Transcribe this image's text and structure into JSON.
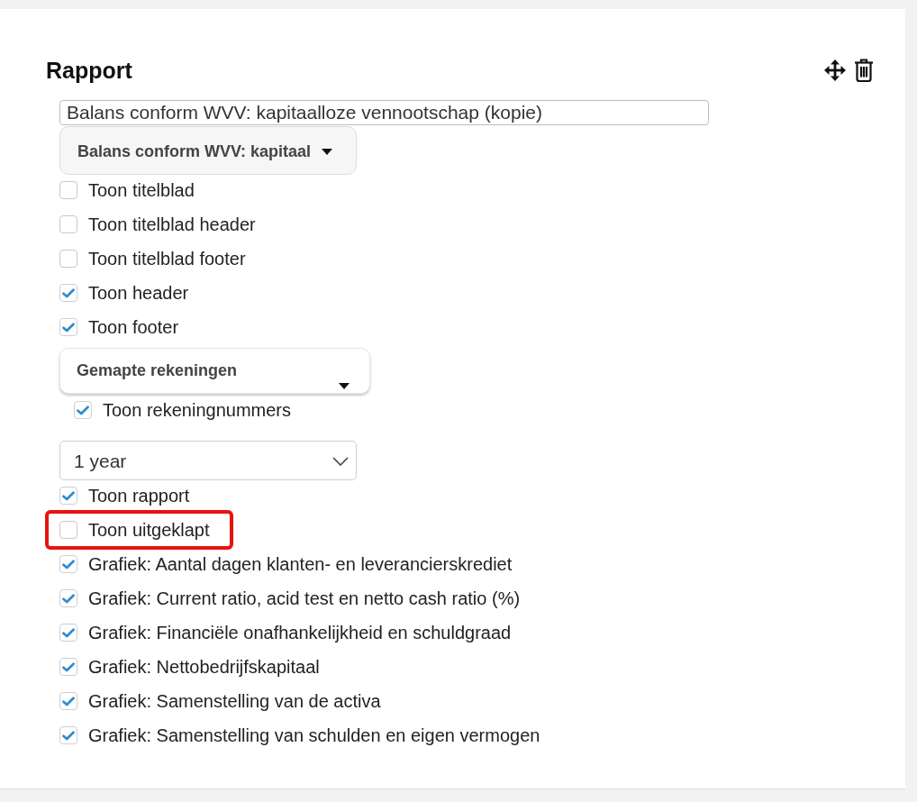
{
  "panel": {
    "title": "Rapport"
  },
  "report_name": {
    "value": "Balans conform WVV: kapitaalloze vennootschap (kopie)"
  },
  "template_menu": {
    "label": "Balans conform WVV: kapitaal"
  },
  "options": [
    {
      "kind": "checkbox",
      "label": "Toon titelblad",
      "checked": false,
      "highlighted": false
    },
    {
      "kind": "checkbox",
      "label": "Toon titelblad header",
      "checked": false,
      "highlighted": false
    },
    {
      "kind": "checkbox",
      "label": "Toon titelblad footer",
      "checked": false,
      "highlighted": false
    },
    {
      "kind": "checkbox",
      "label": "Toon header",
      "checked": true,
      "highlighted": false
    },
    {
      "kind": "checkbox",
      "label": "Toon footer",
      "checked": true,
      "highlighted": false
    },
    {
      "kind": "menu",
      "label": "Gemapte rekeningen",
      "children": [
        {
          "kind": "checkbox",
          "label": "Toon rekeningnummers",
          "checked": true,
          "highlighted": false
        }
      ]
    },
    {
      "kind": "select",
      "value": "1 year"
    },
    {
      "kind": "checkbox",
      "label": "Toon rapport",
      "checked": true,
      "highlighted": false
    },
    {
      "kind": "checkbox",
      "label": "Toon uitgeklapt",
      "checked": false,
      "highlighted": true
    },
    {
      "kind": "checkbox",
      "label": "Grafiek: Aantal dagen klanten- en leverancierskrediet",
      "checked": true,
      "highlighted": false
    },
    {
      "kind": "checkbox",
      "label": "Grafiek: Current ratio, acid test en netto cash ratio (%)",
      "checked": true,
      "highlighted": false
    },
    {
      "kind": "checkbox",
      "label": "Grafiek: Financiële onafhankelijkheid en schuldgraad",
      "checked": true,
      "highlighted": false
    },
    {
      "kind": "checkbox",
      "label": "Grafiek: Nettobedrijfskapitaal",
      "checked": true,
      "highlighted": false
    },
    {
      "kind": "checkbox",
      "label": "Grafiek: Samenstelling van de activa",
      "checked": true,
      "highlighted": false
    },
    {
      "kind": "checkbox",
      "label": "Grafiek: Samenstelling van schulden en eigen vermogen",
      "checked": true,
      "highlighted": false
    }
  ]
}
